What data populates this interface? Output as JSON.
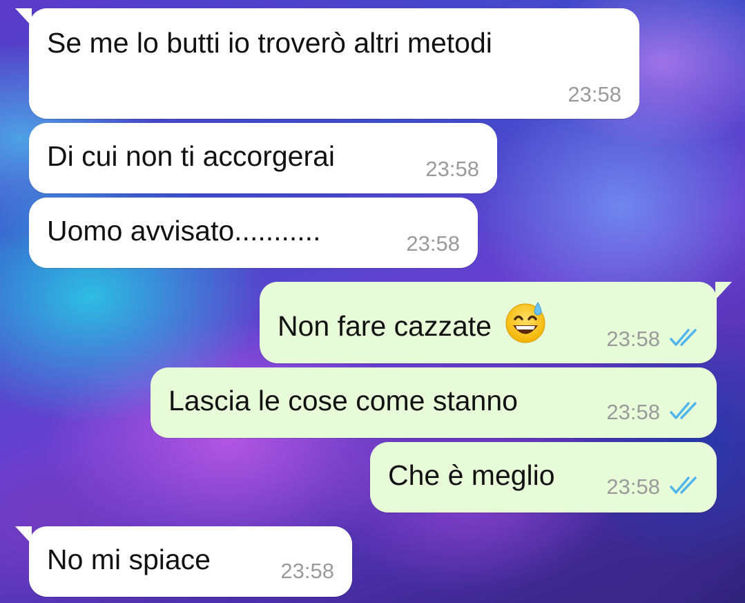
{
  "messages": [
    {
      "direction": "incoming",
      "text": "Se me lo butti io troverò altri metodi",
      "time": "23:58"
    },
    {
      "direction": "incoming",
      "text": "Di cui non ti accorgerai",
      "time": "23:58"
    },
    {
      "direction": "incoming",
      "text": "Uomo avvisato...........",
      "time": "23:58"
    },
    {
      "direction": "outgoing",
      "text": "Non fare cazzate",
      "emoji": "grinning-face-with-sweat-icon",
      "time": "23:58",
      "status": "read"
    },
    {
      "direction": "outgoing",
      "text": "Lascia le cose come stanno",
      "time": "23:58",
      "status": "read"
    },
    {
      "direction": "outgoing",
      "text": "Che è meglio",
      "time": "23:58",
      "status": "read"
    },
    {
      "direction": "incoming",
      "text": "No mi spiace",
      "time": "23:58"
    }
  ],
  "colors": {
    "incoming_bubble": "#ffffff",
    "outgoing_bubble": "#e8fbd9",
    "timestamp": "#9a9a9a",
    "read_ticks": "#4fb6ec"
  }
}
